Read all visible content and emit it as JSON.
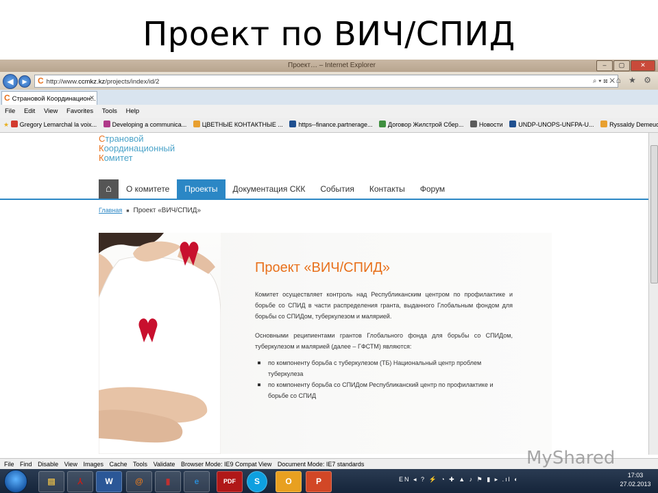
{
  "slide": {
    "title": "Проект по ВИЧ/СПИД"
  },
  "window": {
    "title": "Проект… – Internet Explorer"
  },
  "address": {
    "url_prefix": "http://www.",
    "url_domain": "ccmkz.kz",
    "url_path": "/projects/index/id/2",
    "tools": "⌕ ▾ ⊠ ✕"
  },
  "toolbar_right": "⌂ ★ ⚙",
  "tab": {
    "label": "Страновой Координацион...",
    "close": "✕"
  },
  "menu": [
    "File",
    "Edit",
    "View",
    "Favorites",
    "Tools",
    "Help"
  ],
  "favorites": [
    {
      "label": "Gregory Lemarchal la voix...",
      "color": "#d23b2f"
    },
    {
      "label": "Developing a communica...",
      "color": "#b03a8a"
    },
    {
      "label": "ЦВЕТНЫЕ КОНТАКТНЫЕ ...",
      "color": "#e8a030"
    },
    {
      "label": "https--finance.partnerage...",
      "color": "#1f4f8f"
    },
    {
      "label": "Договор Жилстрой Сбер...",
      "color": "#3f8f3f"
    },
    {
      "label": "Новости",
      "color": "#5a5a5a"
    },
    {
      "label": "UNDP-UNOPS-UNFPA-U...",
      "color": "#1f4f8f"
    },
    {
      "label": "Ryssaldy Demeuova - Out...",
      "color": "#e8a030"
    }
  ],
  "site": {
    "logo": [
      {
        "first": "С",
        "rest": "трановой"
      },
      {
        "first": "К",
        "rest": "оординационный"
      },
      {
        "first": "К",
        "rest": "омитет"
      }
    ],
    "home_glyph": "⌂",
    "nav": [
      "О комитете",
      "Проекты",
      "Документация СКК",
      "События",
      "Контакты",
      "Форум"
    ],
    "nav_active": 1,
    "breadcrumb": {
      "home": "Главная",
      "sep": "■",
      "current": "Проект «ВИЧ/СПИД»"
    },
    "heading": "Проект «ВИЧ/СПИД»",
    "para1": "Комитет осуществляет контроль над Республиканским центром по профилактике и борьбе со СПИД в части распределения гранта, выданного Глобальным фондом для борьбы со СПИДом, туберкулезом и малярией.",
    "para2": "Основными реципиентами грантов Глобального фонда для борьбы со СПИДом, туберкулезом и малярией (далее – ГФСТМ) являются:",
    "bullets": [
      "по компоненту борьба с туберкулезом (ТБ) Национальный центр проблем туберкулеза",
      "по компоненту борьба со СПИДом Республиканский центр по профилактике и борьбе со СПИД"
    ]
  },
  "command_bar": [
    "File",
    "Find",
    "Disable",
    "View",
    "Images",
    "Cache",
    "Tools",
    "Validate",
    "Browser Mode: IE9 Compat View",
    "Document Mode: IE7 standards"
  ],
  "taskbar": {
    "apps": [
      {
        "icon": "folder-icon",
        "glyph": "▤",
        "color": "#e0b84a"
      },
      {
        "icon": "acrobat-icon",
        "glyph": "⅄",
        "color": "#c0201a"
      },
      {
        "icon": "word-icon",
        "glyph": "W",
        "color": "#2b5797"
      },
      {
        "icon": "mail-icon",
        "glyph": "@",
        "color": "#e87a1c"
      },
      {
        "icon": "book-icon",
        "glyph": "▮",
        "color": "#c03030"
      },
      {
        "icon": "ie-icon",
        "glyph": "e",
        "color": "#2a8ad4"
      },
      {
        "icon": "pdf-icon",
        "glyph": "PDF",
        "color": "#b01818"
      },
      {
        "icon": "skype-icon",
        "glyph": "S",
        "color": "#0ea0e0"
      },
      {
        "icon": "outlook-icon",
        "glyph": "O",
        "color": "#e8a020"
      },
      {
        "icon": "powerpoint-icon",
        "glyph": "P",
        "color": "#d24726"
      }
    ],
    "tray": "EN ◂ ? ⚡ ◔ ✚ ▲ ♪ ⚑ ▮ ▸ .ıl ◐",
    "time": "17:03",
    "date": "27.02.2013"
  },
  "watermark": "MyShared"
}
